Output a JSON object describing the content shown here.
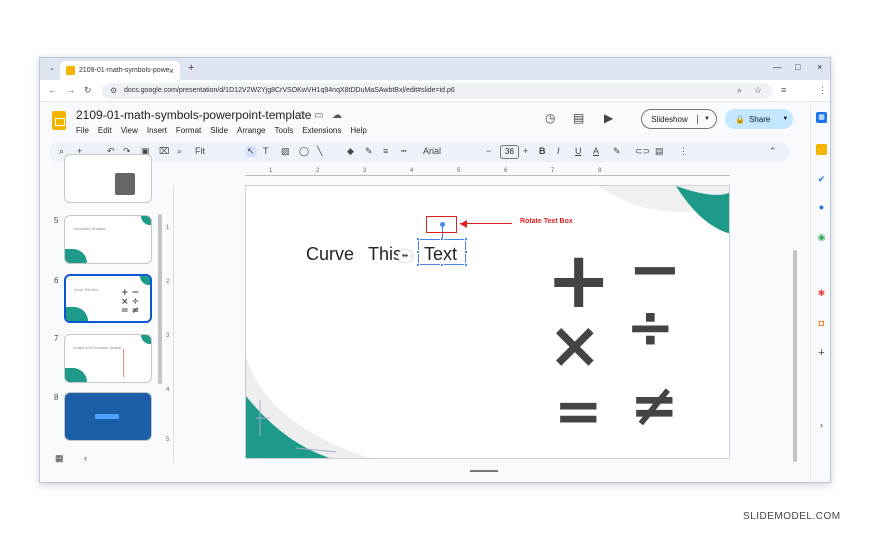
{
  "browser": {
    "tab_title": "2109-01-math-symbols-powerp",
    "tab_close": "×",
    "new_tab": "+",
    "tab_dropdown": "⌄",
    "url": "docs.google.com/presentation/d/1D12V2W2Yjg8CrVSOKwVH1q94nqX8tDDuMaSAwbtBxl/edit#slide=id.p6",
    "window_controls": [
      "—",
      "□",
      "×"
    ]
  },
  "doc": {
    "title": "2109-01-math-symbols-powerpoint-template",
    "menu": [
      "File",
      "Edit",
      "View",
      "Insert",
      "Format",
      "Slide",
      "Arrange",
      "Tools",
      "Extensions",
      "Help"
    ],
    "slideshow_label": "Slideshow",
    "share_label": "Share"
  },
  "toolbar": {
    "zoom": "Fit",
    "font": "Arial",
    "font_size": "36",
    "buttons": [
      "B",
      "I",
      "U",
      "A"
    ]
  },
  "filmstrip": {
    "slides": [
      {
        "num": "5",
        "label": "Geometry Shapes"
      },
      {
        "num": "6",
        "label": "Curve  This  text"
      },
      {
        "num": "7",
        "label": "Graph of a Function Shape"
      },
      {
        "num": "8",
        "label": "SlideModel"
      }
    ]
  },
  "ruler": {
    "marks": [
      "1",
      "2",
      "3",
      "4",
      "5",
      "6",
      "7",
      "8"
    ],
    "vmarks": [
      "1",
      "2",
      "3",
      "4",
      "5"
    ]
  },
  "slide": {
    "words": [
      "Curve",
      "This",
      "Text"
    ],
    "annotation": "Rotate Text Box",
    "symbols": [
      "+",
      "−",
      "×",
      "÷",
      "=",
      "≠"
    ],
    "accent_color": "#1d9a8a"
  },
  "watermark": "SLIDEMODEL.COM"
}
